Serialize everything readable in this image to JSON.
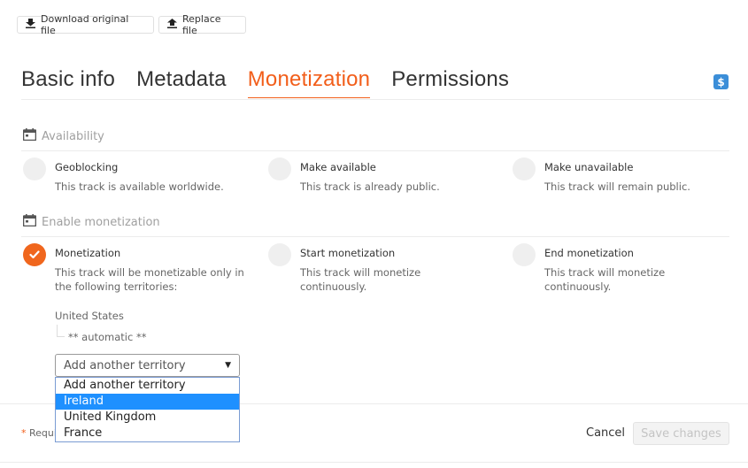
{
  "toolbar": {
    "download_label": "Download original file",
    "replace_label": "Replace file"
  },
  "tabs": [
    {
      "label": "Basic info",
      "active": false
    },
    {
      "label": "Metadata",
      "active": false
    },
    {
      "label": "Monetization",
      "active": true
    },
    {
      "label": "Permissions",
      "active": false
    }
  ],
  "badge": {
    "symbol": "$",
    "icon": "dollar-icon",
    "color": "#3b8ed8"
  },
  "availability": {
    "heading": "Availability",
    "icon": "calendar-icon",
    "options": [
      {
        "title": "Geoblocking",
        "desc": "This track is available worldwide.",
        "checked": false
      },
      {
        "title": "Make available",
        "desc": "This track is already public.",
        "checked": false
      },
      {
        "title": "Make unavailable",
        "desc": "This track will remain public.",
        "checked": false
      }
    ]
  },
  "monetization": {
    "heading": "Enable monetization",
    "icon": "calendar-icon",
    "options": [
      {
        "title": "Monetization",
        "desc": "This track will be monetizable only in the following territories:",
        "checked": true
      },
      {
        "title": "Start monetization",
        "desc": "This track will monetize continuously.",
        "checked": false
      },
      {
        "title": "End monetization",
        "desc": "This track will monetize continuously.",
        "checked": false
      }
    ],
    "territory": "United States",
    "territory_note": "** automatic **",
    "select": {
      "value": "Add another territory",
      "options": [
        "Add another territory",
        "Ireland",
        "United Kingdom",
        "France"
      ],
      "highlighted": "Ireland"
    }
  },
  "footer": {
    "required_star": "*",
    "required_label": "Required fields",
    "cancel_label": "Cancel",
    "save_label": "Save changes"
  },
  "colors": {
    "accent": "#f25e1a",
    "highlight": "#1e90ff"
  }
}
